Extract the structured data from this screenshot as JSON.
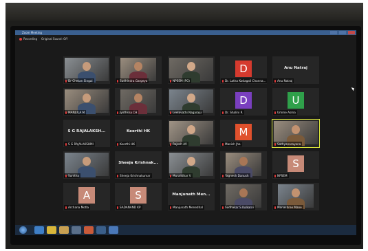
{
  "window": {
    "title": "Zoom Meeting",
    "recording_label": "Recording",
    "sound_label": "Original Sound: Off"
  },
  "participants": [
    {
      "name": "Dr Chetan Singai",
      "kind": "video"
    },
    {
      "name": "Sudhindra Gargeya",
      "kind": "video"
    },
    {
      "name": "NPSEM (PG)",
      "kind": "video"
    },
    {
      "name": "Dr. Latha Kodagali Channa...",
      "kind": "avatar",
      "initial": "D",
      "color": "#d53a2e"
    },
    {
      "name": "Anu Natraj",
      "kind": "text",
      "big_name": "Anu Natraj"
    },
    {
      "name": "MANJULA M",
      "kind": "video"
    },
    {
      "name": "Jyothsna CH",
      "kind": "video"
    },
    {
      "name": "Leelavathi Nagaraju",
      "kind": "video"
    },
    {
      "name": "Dr. Shalini R",
      "kind": "avatar",
      "initial": "D",
      "color": "#7a3fbf"
    },
    {
      "name": "Umme Asma",
      "kind": "avatar",
      "initial": "U",
      "color": "#2fa04a"
    },
    {
      "name": "S G RAJALAKSHMI",
      "kind": "text",
      "big_name": "S G RAJALAKSH..."
    },
    {
      "name": "Keerthi HK",
      "kind": "text",
      "big_name": "Keerthi HK"
    },
    {
      "name": "Rajesh AV",
      "kind": "video"
    },
    {
      "name": "Manish Jha",
      "kind": "avatar",
      "initial": "M",
      "color": "#e0512d"
    },
    {
      "name": "Sathyanarayana",
      "kind": "video",
      "active": true
    },
    {
      "name": "Sunitha",
      "kind": "video"
    },
    {
      "name": "Sheeja Krishnakumar",
      "kind": "text",
      "big_name": "Sheeja Krishnak..."
    },
    {
      "name": "Muralidhar V",
      "kind": "video"
    },
    {
      "name": "Yagnesh Danush",
      "kind": "video"
    },
    {
      "name": "NPSEM",
      "kind": "avatar",
      "initial": "S",
      "color": "#c78a78"
    },
    {
      "name": "Archana Motla",
      "kind": "avatar",
      "initial": "A",
      "color": "#c78a78"
    },
    {
      "name": "SADANAND KP",
      "kind": "avatar",
      "initial": "S",
      "color": "#c78a78"
    },
    {
      "name": "Manjunath Menedhal",
      "kind": "text",
      "big_name": "Manjunath Men..."
    },
    {
      "name": "Sudhakar S Kulkarni",
      "kind": "video"
    },
    {
      "name": "Manashree Mane",
      "kind": "video"
    }
  ],
  "colors": {
    "screen_bg": "#1a1a1a",
    "tile_bg": "#262626",
    "active_border": "#d7e23a",
    "muted_mic": "#e23b3b",
    "taskbar": "#1b2b3f"
  },
  "taskbar": {
    "icons": [
      "windows-start-icon",
      "ie-icon",
      "chrome-icon",
      "folder-icon",
      "media-icon",
      "office-icon",
      "zoom-icon",
      "word-icon"
    ]
  }
}
